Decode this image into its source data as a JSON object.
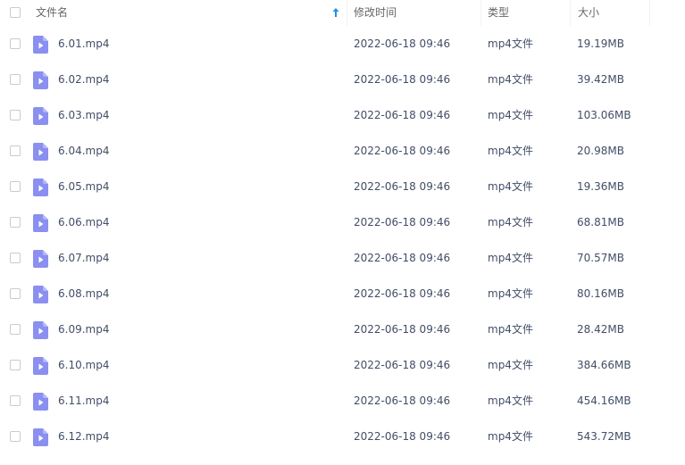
{
  "header": {
    "name_label": "文件名",
    "time_label": "修改时间",
    "type_label": "类型",
    "size_label": "大小",
    "sort_icon": "arrow-up-icon",
    "sort_color": "#1e90e8"
  },
  "file_icon": {
    "name": "video-file-icon",
    "color": "#8a8ff0"
  },
  "files": [
    {
      "name": "6.01.mp4",
      "modified": "2022-06-18 09:46",
      "type": "mp4文件",
      "size": "19.19MB"
    },
    {
      "name": "6.02.mp4",
      "modified": "2022-06-18 09:46",
      "type": "mp4文件",
      "size": "39.42MB"
    },
    {
      "name": "6.03.mp4",
      "modified": "2022-06-18 09:46",
      "type": "mp4文件",
      "size": "103.06MB"
    },
    {
      "name": "6.04.mp4",
      "modified": "2022-06-18 09:46",
      "type": "mp4文件",
      "size": "20.98MB"
    },
    {
      "name": "6.05.mp4",
      "modified": "2022-06-18 09:46",
      "type": "mp4文件",
      "size": "19.36MB"
    },
    {
      "name": "6.06.mp4",
      "modified": "2022-06-18 09:46",
      "type": "mp4文件",
      "size": "68.81MB"
    },
    {
      "name": "6.07.mp4",
      "modified": "2022-06-18 09:46",
      "type": "mp4文件",
      "size": "70.57MB"
    },
    {
      "name": "6.08.mp4",
      "modified": "2022-06-18 09:46",
      "type": "mp4文件",
      "size": "80.16MB"
    },
    {
      "name": "6.09.mp4",
      "modified": "2022-06-18 09:46",
      "type": "mp4文件",
      "size": "28.42MB"
    },
    {
      "name": "6.10.mp4",
      "modified": "2022-06-18 09:46",
      "type": "mp4文件",
      "size": "384.66MB"
    },
    {
      "name": "6.11.mp4",
      "modified": "2022-06-18 09:46",
      "type": "mp4文件",
      "size": "454.16MB"
    },
    {
      "name": "6.12.mp4",
      "modified": "2022-06-18 09:46",
      "type": "mp4文件",
      "size": "543.72MB"
    }
  ]
}
